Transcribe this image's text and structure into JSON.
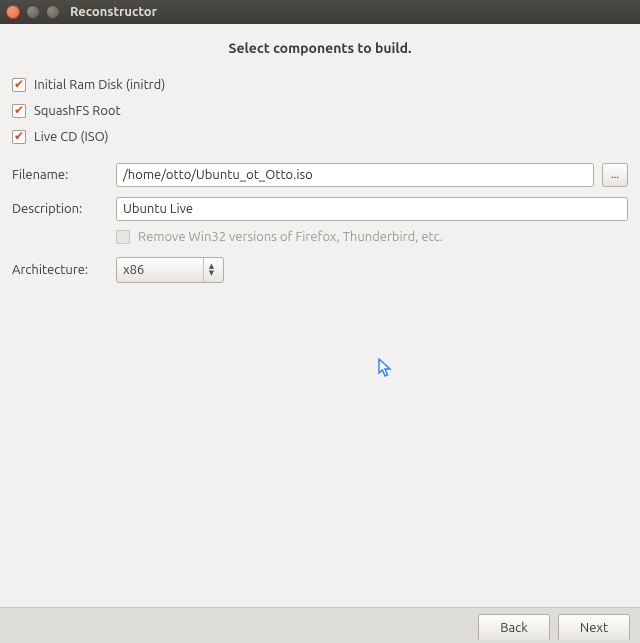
{
  "window": {
    "title": "Reconstructor"
  },
  "heading": "Select components to build.",
  "checks": {
    "initrd_label": "Initial Ram Disk (initrd)",
    "squashfs_label": "SquashFS Root",
    "livecd_label": "Live CD (ISO)"
  },
  "form": {
    "filename_label": "Filename:",
    "filename_value": "/home/otto/Ubuntu_ot_Otto.iso",
    "browse_label": "...",
    "description_label": "Description:",
    "description_value": "Ubuntu Live",
    "remove_win32_label": "Remove Win32 versions of Firefox, Thunderbird, etc.",
    "architecture_label": "Architecture:",
    "architecture_value": "x86"
  },
  "footer": {
    "back_label": "Back",
    "next_label": "Next"
  }
}
